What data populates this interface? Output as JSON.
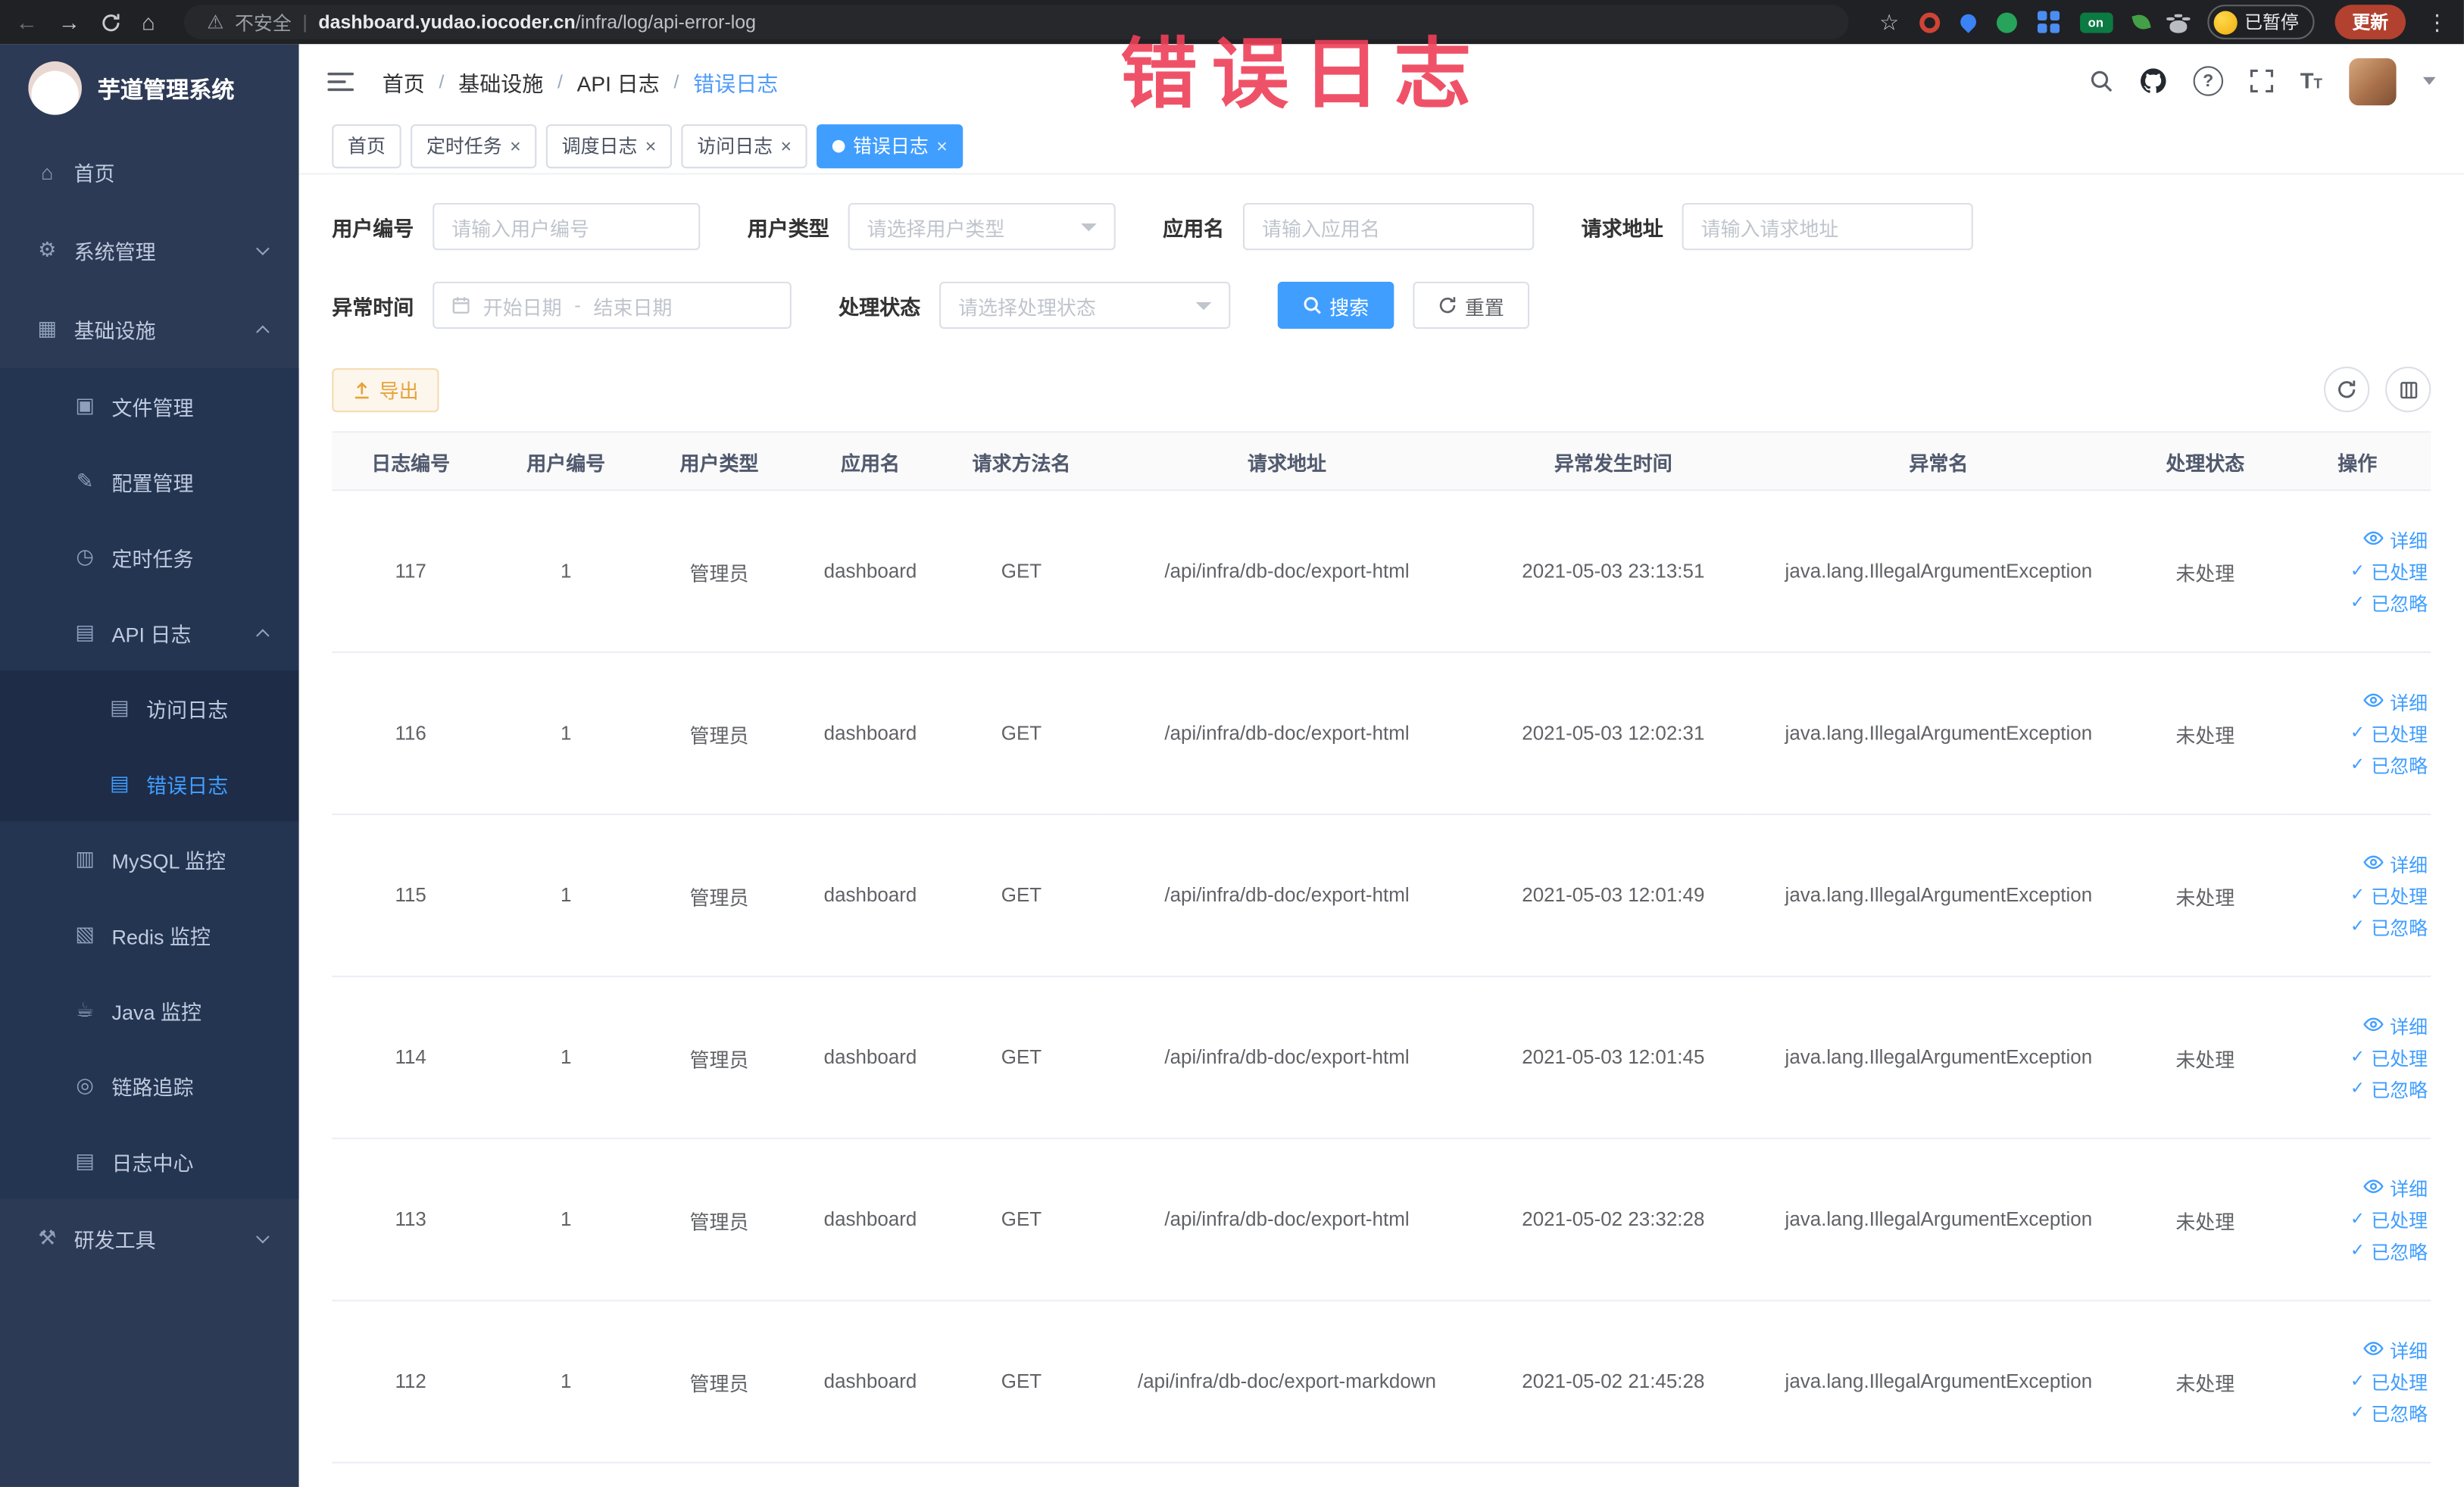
{
  "annotation": {
    "text": "错误日志"
  },
  "colors": {
    "accent": "#409EFF",
    "sidebar_bg": "#2d3a55",
    "warning": "#e6a23c",
    "annotation_red": "#ee4058"
  },
  "browser": {
    "security_label": "不安全",
    "url_domain": "dashboard.yudao.iocoder.cn",
    "url_path": "/infra/log/api-error-log",
    "on_badge": "on",
    "paused_badge": "已暂停",
    "update_label": "更新"
  },
  "sidebar": {
    "logo_title": "芋道管理系统",
    "items": [
      {
        "name": "home",
        "label": "首页",
        "icon": "home-icon",
        "level": 1
      },
      {
        "name": "system",
        "label": "系统管理",
        "icon": "gear-icon",
        "level": 1,
        "chevron": "down"
      },
      {
        "name": "infra",
        "label": "基础设施",
        "icon": "infra-icon",
        "level": 1,
        "chevron": "up"
      },
      {
        "name": "file",
        "label": "文件管理",
        "icon": "file-icon",
        "level": 2
      },
      {
        "name": "config",
        "label": "配置管理",
        "icon": "config-icon",
        "level": 2
      },
      {
        "name": "job",
        "label": "定时任务",
        "icon": "timer-icon",
        "level": 2
      },
      {
        "name": "api-log",
        "label": "API 日志",
        "icon": "doc-icon",
        "level": 2,
        "chevron": "up"
      },
      {
        "name": "access-log",
        "label": "访问日志",
        "icon": "doc-icon",
        "level": 3
      },
      {
        "name": "error-log",
        "label": "错误日志",
        "icon": "doc-icon",
        "level": 3,
        "active": true
      },
      {
        "name": "mysql",
        "label": "MySQL 监控",
        "icon": "database-icon",
        "level": 2
      },
      {
        "name": "redis",
        "label": "Redis 监控",
        "icon": "redis-icon",
        "level": 2
      },
      {
        "name": "java",
        "label": "Java 监控",
        "icon": "java-icon",
        "level": 2
      },
      {
        "name": "trace",
        "label": "链路追踪",
        "icon": "trace-icon",
        "level": 2
      },
      {
        "name": "log-center",
        "label": "日志中心",
        "icon": "doc-icon",
        "level": 2
      },
      {
        "name": "devtools",
        "label": "研发工具",
        "icon": "tools-icon",
        "level": 1,
        "chevron": "down"
      }
    ]
  },
  "breadcrumb": {
    "separator": "/",
    "items": [
      "首页",
      "基础设施",
      "API 日志",
      "错误日志"
    ]
  },
  "tabs": [
    {
      "name": "home",
      "label": "首页",
      "closable": false,
      "active": false
    },
    {
      "name": "job",
      "label": "定时任务",
      "closable": true,
      "active": false
    },
    {
      "name": "job-log",
      "label": "调度日志",
      "closable": true,
      "active": false
    },
    {
      "name": "access-log",
      "label": "访问日志",
      "closable": true,
      "active": false
    },
    {
      "name": "error-log",
      "label": "错误日志",
      "closable": true,
      "active": true
    }
  ],
  "filters": {
    "user_id": {
      "label": "用户编号",
      "placeholder": "请输入用户编号"
    },
    "user_type": {
      "label": "用户类型",
      "placeholder": "请选择用户类型"
    },
    "app_name": {
      "label": "应用名",
      "placeholder": "请输入应用名"
    },
    "request_url": {
      "label": "请求地址",
      "placeholder": "请输入请求地址"
    },
    "exception_time": {
      "label": "异常时间",
      "start_placeholder": "开始日期",
      "separator": "-",
      "end_placeholder": "结束日期"
    },
    "status": {
      "label": "处理状态",
      "placeholder": "请选择处理状态"
    },
    "search_label": "搜索",
    "reset_label": "重置"
  },
  "toolbar": {
    "export_label": "导出"
  },
  "table": {
    "columns": [
      "日志编号",
      "用户编号",
      "用户类型",
      "应用名",
      "请求方法名",
      "请求地址",
      "异常发生时间",
      "异常名",
      "处理状态",
      "操作"
    ],
    "actions": [
      {
        "name": "detail",
        "label": "详细",
        "icon": "eye-icon"
      },
      {
        "name": "processed",
        "label": "已处理",
        "icon": "check-icon"
      },
      {
        "name": "ignored",
        "label": "已忽略",
        "icon": "check-icon"
      }
    ],
    "rows": [
      {
        "log_id": "117",
        "user_id": "1",
        "user_type": "管理员",
        "app_name": "dashboard",
        "method": "GET",
        "url": "/api/infra/db-doc/export-html",
        "time": "2021-05-03 23:13:51",
        "exception": "java.lang.IllegalArgumentException",
        "status": "未处理"
      },
      {
        "log_id": "116",
        "user_id": "1",
        "user_type": "管理员",
        "app_name": "dashboard",
        "method": "GET",
        "url": "/api/infra/db-doc/export-html",
        "time": "2021-05-03 12:02:31",
        "exception": "java.lang.IllegalArgumentException",
        "status": "未处理"
      },
      {
        "log_id": "115",
        "user_id": "1",
        "user_type": "管理员",
        "app_name": "dashboard",
        "method": "GET",
        "url": "/api/infra/db-doc/export-html",
        "time": "2021-05-03 12:01:49",
        "exception": "java.lang.IllegalArgumentException",
        "status": "未处理"
      },
      {
        "log_id": "114",
        "user_id": "1",
        "user_type": "管理员",
        "app_name": "dashboard",
        "method": "GET",
        "url": "/api/infra/db-doc/export-html",
        "time": "2021-05-03 12:01:45",
        "exception": "java.lang.IllegalArgumentException",
        "status": "未处理"
      },
      {
        "log_id": "113",
        "user_id": "1",
        "user_type": "管理员",
        "app_name": "dashboard",
        "method": "GET",
        "url": "/api/infra/db-doc/export-html",
        "time": "2021-05-02 23:32:28",
        "exception": "java.lang.IllegalArgumentException",
        "status": "未处理"
      },
      {
        "log_id": "112",
        "user_id": "1",
        "user_type": "管理员",
        "app_name": "dashboard",
        "method": "GET",
        "url": "/api/infra/db-doc/export-markdown",
        "time": "2021-05-02 21:45:28",
        "exception": "java.lang.IllegalArgumentException",
        "status": "未处理"
      }
    ]
  }
}
